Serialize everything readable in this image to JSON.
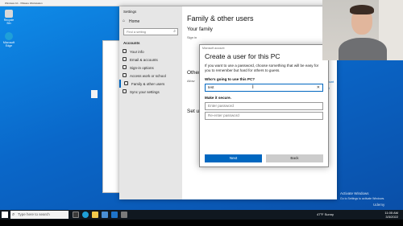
{
  "vm": {
    "title": "Windows 10 - VMware Workstation",
    "controls": "— ☐ ✕"
  },
  "desktop": {
    "icons": [
      {
        "label": "Recycle Bin",
        "icon": "recycle-bin-icon",
        "color": "#d8d8d8"
      },
      {
        "label": "Microsoft Edge",
        "icon": "edge-icon",
        "color": "#1fa0d8"
      }
    ],
    "file_icon": "file-icon"
  },
  "settings": {
    "title": "Settings",
    "home": "Home",
    "find_placeholder": "Find a setting",
    "section": "Accounts",
    "nav": [
      {
        "label": "Your info"
      },
      {
        "label": "Email & accounts"
      },
      {
        "label": "Sign-in options"
      },
      {
        "label": "Access work or school"
      },
      {
        "label": "Family & other users"
      },
      {
        "label": "Sync your settings"
      }
    ],
    "page_title": "Family & other users",
    "your_family": "Your family",
    "sign_in_text": "Sign in",
    "other_heading": "Other",
    "allow_text": "Allow",
    "setup_heading": "Set up",
    "right_panel": {
      "bring": "Bring",
      "phone": "phone",
      "links": [
        "…local user account",
        "…a local account",
        "…user limits"
      ],
      "feedback": "…feedback"
    }
  },
  "dialog": {
    "caption": "Microsoft account",
    "title": "Create a user for this PC",
    "intro": "If you want to use a password, choose something that will be easy for you to remember but hard for others to guess.",
    "who_label": "Who's going to use this PC?",
    "username_value": "test",
    "secure_label": "Make it secure.",
    "password_placeholder": "Enter password",
    "reenter_placeholder": "Re-enter password",
    "next_label": "Next",
    "back_label": "Back"
  },
  "watermark": {
    "title": "Activate Windows",
    "subtitle": "Go to Settings to activate Windows."
  },
  "udemy": "Udemy",
  "taskbar": {
    "search_placeholder": "Type here to search",
    "weather": "47°F Sunny",
    "time": "11:05 AM",
    "date": "3/3/2022"
  },
  "colors": {
    "accent": "#0067c0",
    "taskbar": "#101820"
  }
}
